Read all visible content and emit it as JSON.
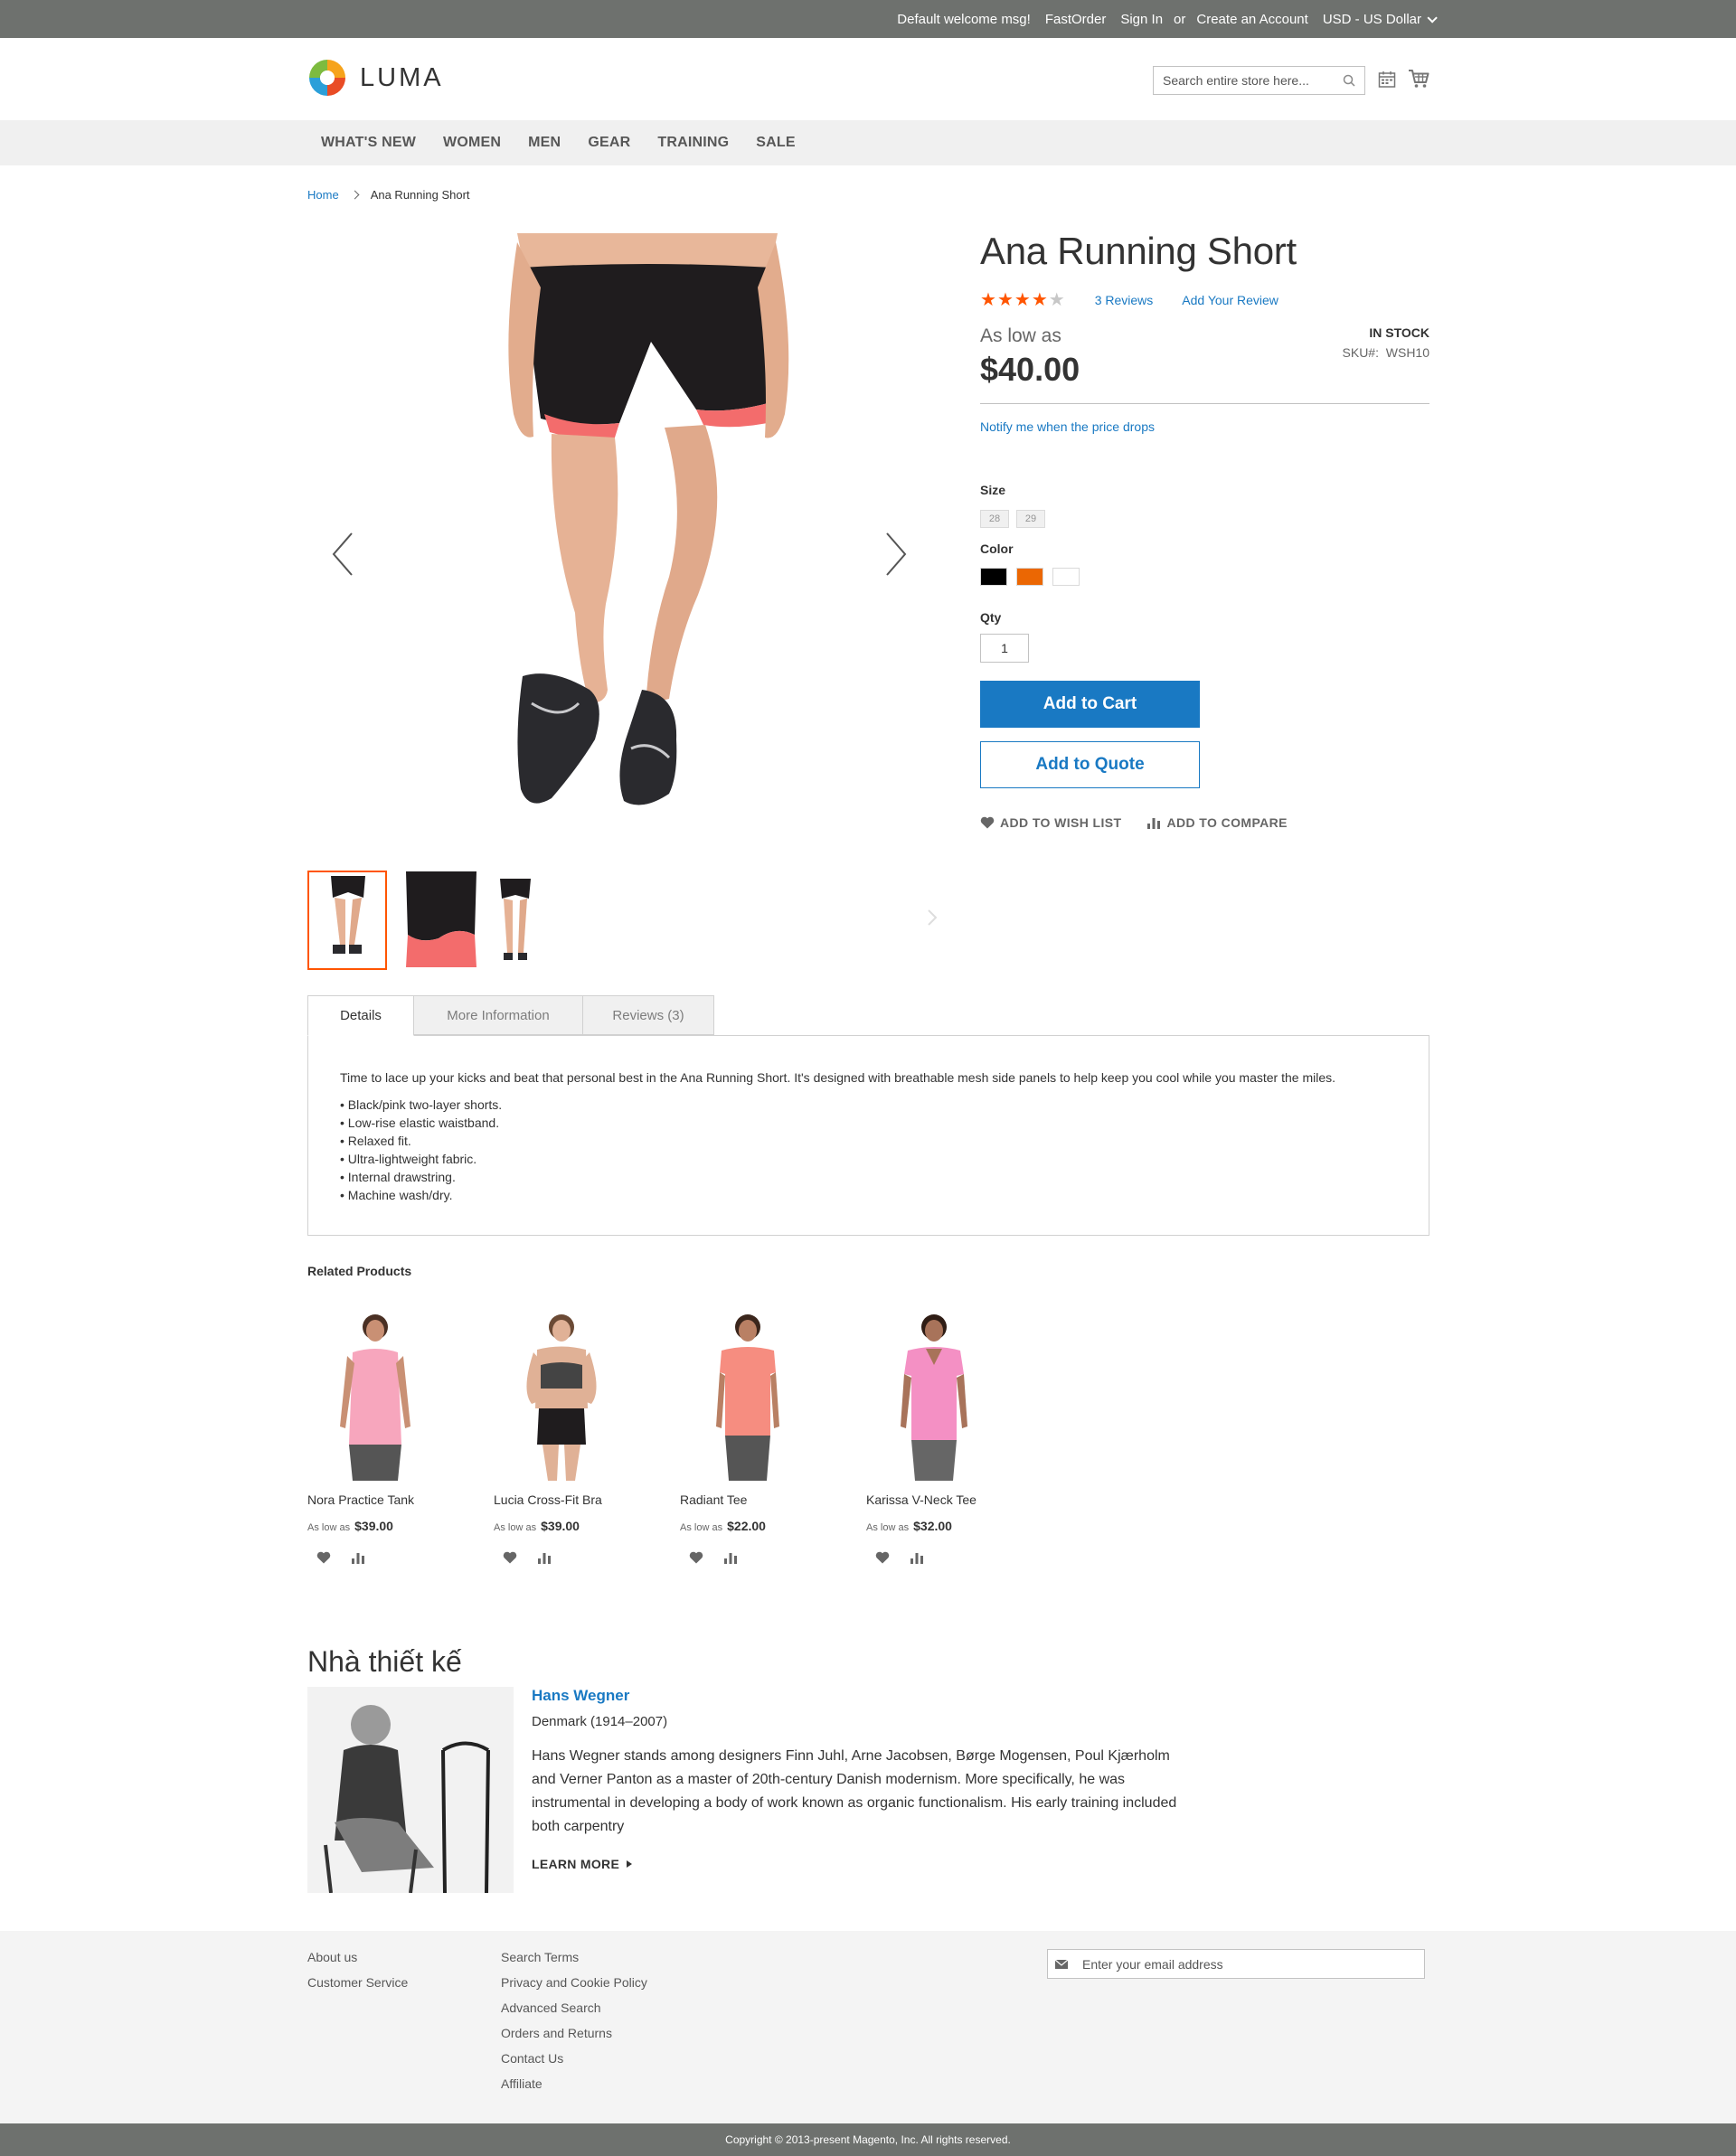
{
  "topbar": {
    "welcome": "Default welcome msg!",
    "fastorder": "FastOrder",
    "sign_in": "Sign In",
    "or": "or",
    "create_account": "Create an Account",
    "currency": "USD - US Dollar"
  },
  "header": {
    "logo_text": "LUMA",
    "search_placeholder": "Search entire store here..."
  },
  "nav": {
    "items": [
      "What's New",
      "Women",
      "Men",
      "Gear",
      "Training",
      "Sale"
    ]
  },
  "breadcrumb": {
    "home": "Home",
    "current": "Ana Running Short"
  },
  "product": {
    "title": "Ana Running Short",
    "rating_stars": 4,
    "rating_max": 5,
    "reviews_link": "3  Reviews",
    "add_review": "Add Your Review",
    "as_low_as": "As low as",
    "price": "$40.00",
    "stock": "In stock",
    "sku_label": "SKU#:",
    "sku": "WSH10",
    "notify": "Notify me when the price drops",
    "size_label": "Size",
    "sizes": [
      "28",
      "29"
    ],
    "color_label": "Color",
    "colors": [
      "#000000",
      "#eb6703",
      "#ffffff"
    ],
    "qty_label": "Qty",
    "qty": "1",
    "add_to_cart": "Add to Cart",
    "add_to_quote": "Add to Quote",
    "wish_list": "Add to Wish List",
    "compare": "Add to Compare"
  },
  "tabs": {
    "details": "Details",
    "more_info": "More Information",
    "reviews": "Reviews (3)"
  },
  "details": {
    "intro": "Time to lace up your kicks and beat that personal best in the Ana Running Short. It's designed with breathable mesh side panels to help keep you cool while you master the miles.",
    "bullets": [
      "• Black/pink two-layer shorts.",
      "• Low-rise elastic waistband.",
      "• Relaxed fit.",
      "• Ultra-lightweight fabric.",
      "• Internal drawstring.",
      "• Machine wash/dry."
    ]
  },
  "related": {
    "title": "Related Products",
    "items": [
      {
        "name": "Nora Practice Tank",
        "as_low_as": "As low as",
        "price": "$39.00"
      },
      {
        "name": "Lucia Cross-Fit Bra",
        "as_low_as": "As low as",
        "price": "$39.00"
      },
      {
        "name": "Radiant Tee",
        "as_low_as": "As low as",
        "price": "$22.00"
      },
      {
        "name": "Karissa V-Neck Tee",
        "as_low_as": "As low as",
        "price": "$32.00"
      }
    ]
  },
  "designer": {
    "heading": "Nhà thiết kế",
    "name": "Hans Wegner",
    "origin": "Denmark (1914–2007)",
    "bio": "Hans Wegner stands among designers Finn Juhl, Arne Jacobsen, Børge Mogensen, Poul Kjærholm and Verner Panton as a master of 20th-century Danish modernism. More specifically, he was instrumental in developing a body of work known as organic functionalism. His early training included both carpentry",
    "learn_more": "LEARN MORE"
  },
  "footer": {
    "col1": [
      "About us",
      "Customer Service"
    ],
    "col2": [
      "Search Terms",
      "Privacy and Cookie Policy",
      "Advanced Search",
      "Orders and Returns",
      "Contact Us",
      "Affiliate"
    ],
    "newsletter_placeholder": "Enter your email address",
    "copyright": "Copyright © 2013-present Magento, Inc. All rights reserved."
  },
  "colors": {
    "accent": "#1979c3",
    "star": "#ff5501",
    "topbar": "#6e716e"
  }
}
